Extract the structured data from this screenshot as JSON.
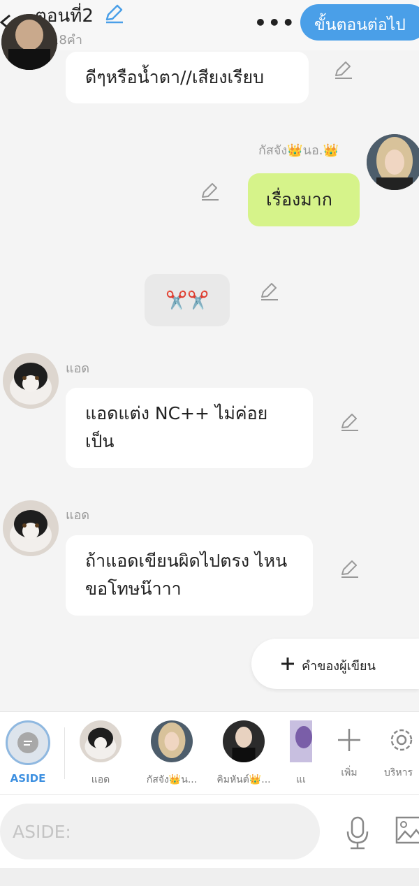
{
  "header": {
    "episode_title": "ตอนที่2",
    "word_count": "3018คำ",
    "more_label": "•••",
    "next_button": "ขั้นตอนต่อไป"
  },
  "messages": [
    {
      "text": "ดีๆหรือน้ำตา//เสียงเรียบ"
    },
    {
      "author": "กัสจัง👑นอ.👑",
      "text": "เรื่องมาก"
    },
    {
      "text": "✂️✂️"
    },
    {
      "author": "แอด",
      "text": "แอดแต่ง  NC++  ไม่ค่อย เป็น"
    },
    {
      "author": "แอด",
      "text": "ถ้าแอดเขียนผิดไปตรง ไหนขอโทษน๊าาา"
    }
  ],
  "author_note_button": "คำของผู้เขียน",
  "character_bar": {
    "aside_label": "ASIDE",
    "characters": [
      {
        "name": "แอด"
      },
      {
        "name": "กัสจัง👑น..."
      },
      {
        "name": "คิมหันต์👑..."
      },
      {
        "name": "แเ"
      }
    ],
    "add_label": "เพิ่ม",
    "manage_label": "บริหาร"
  },
  "input": {
    "placeholder": "ASIDE:"
  },
  "colors": {
    "accent": "#4a9fe8",
    "self_bubble": "#d6f38a",
    "background": "#f4f4f4"
  }
}
